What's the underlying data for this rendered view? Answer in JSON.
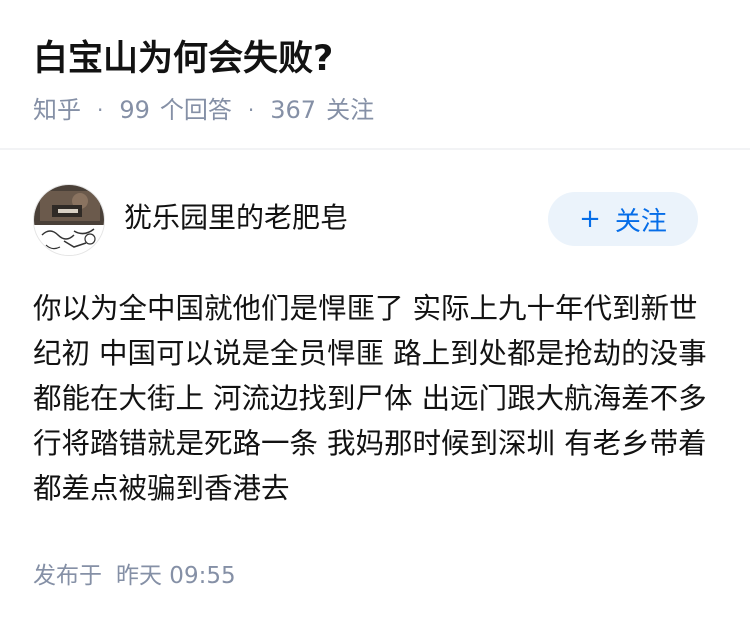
{
  "question": {
    "title": "白宝山为何会失败?",
    "source": "知乎",
    "separator": "·",
    "answer_count": "99",
    "answer_label": "个回答",
    "follower_count": "367",
    "follower_label": "关注"
  },
  "author": {
    "name": "犹乐园里的老肥皂",
    "avatar_icon": "user-avatar-image"
  },
  "follow_button": {
    "icon": "+",
    "label": "关注"
  },
  "answer": {
    "text": "你以为全中国就他们是悍匪了 实际上九十年代到新世纪初 中国可以说是全员悍匪 路上到处都是抢劫的没事都能在大街上 河流边找到尸体 出远门跟大航海差不多 行将踏错就是死路一条 我妈那时候到深圳 有老乡带着都差点被骗到香港去",
    "published_label": "发布于",
    "published_time": "昨天 09:55"
  },
  "colors": {
    "meta_text": "#8590a6",
    "follow_bg": "#ebf3fb",
    "follow_text": "#056de8",
    "body_text": "#121212"
  }
}
